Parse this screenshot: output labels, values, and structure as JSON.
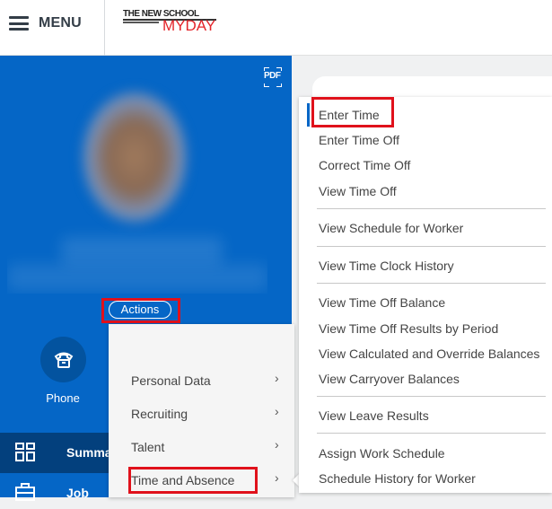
{
  "header": {
    "menu_label": "MENU",
    "logo_top": "THE NEW SCHOOL",
    "logo_bottom": "MYDAY"
  },
  "profile": {
    "pdf_label": "PDF",
    "actions_label": "Actions",
    "phone_label": "Phone",
    "nav": [
      {
        "label": "Summary",
        "icon": "dashboard-icon",
        "active": true
      },
      {
        "label": "Job",
        "icon": "briefcase-icon",
        "active": false
      }
    ]
  },
  "actions_menu": {
    "items": [
      {
        "label": "Personal Data",
        "has_submenu": true
      },
      {
        "label": "Recruiting",
        "has_submenu": true
      },
      {
        "label": "Talent",
        "has_submenu": true
      },
      {
        "label": "Time and Absence",
        "has_submenu": true,
        "highlighted": true
      }
    ]
  },
  "submenu": {
    "groups": [
      [
        "Enter Time",
        "Enter Time Off",
        "Correct Time Off",
        "View Time Off"
      ],
      [
        "View Schedule for Worker"
      ],
      [
        "View Time Clock History"
      ],
      [
        "View Time Off Balance",
        "View Time Off Results by Period",
        "View Calculated and Override Balances",
        "View Carryover Balances"
      ],
      [
        "View Leave Results"
      ],
      [
        "Assign Work Schedule",
        "Schedule History for Worker"
      ]
    ],
    "highlighted": "Enter Time"
  },
  "colors": {
    "brand_blue": "#0566c6",
    "nav_active": "#03407d",
    "highlight_red": "#e0111b",
    "logo_red": "#e4252b"
  }
}
